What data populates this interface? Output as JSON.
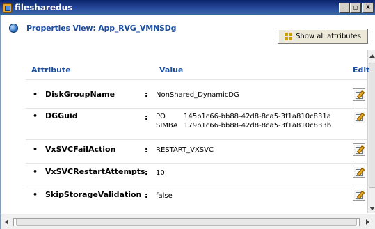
{
  "window": {
    "title": "filesharedus",
    "min_label": "_",
    "max_label": "□",
    "close_label": "X"
  },
  "header": {
    "title": "Properties View: App_RVG_VMNSDg",
    "show_all_label": "Show all attributes"
  },
  "table": {
    "col_attribute": "Attribute",
    "col_value": "Value",
    "col_edit": "Edit",
    "rows": [
      {
        "name": "DiskGroupName",
        "value": "NonShared_DynamicDG"
      },
      {
        "name": "DGGuid",
        "guids": [
          {
            "label": "PO",
            "value": "145b1c66-bb88-42d8-8ca5-3f1a810c831a"
          },
          {
            "label": "SIMBA",
            "value": "179b1c66-bb88-42d8-8ca5-3f1a810c833b"
          }
        ]
      },
      {
        "name": "VxSVCFailAction",
        "value": "RESTART_VXSVC"
      },
      {
        "name": "VxSVCRestartAttempts",
        "value": "10"
      },
      {
        "name": "SkipStorageValidation",
        "value": "false"
      }
    ]
  },
  "colors": {
    "header_blue": "#1d4fa0",
    "titlebar": "#0a246a"
  }
}
